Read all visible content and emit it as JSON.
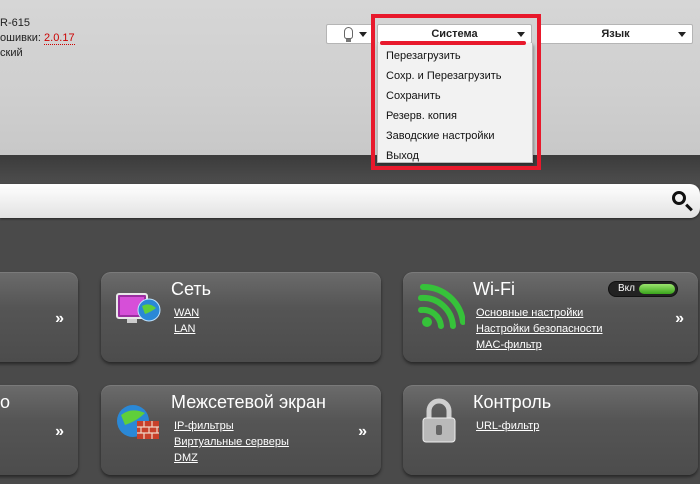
{
  "device": {
    "model_line": "R-615",
    "firmware_label": "ошивки:",
    "firmware_version": "2.0.17",
    "lang_line": "ский"
  },
  "topbar": {
    "system_label": "Система",
    "language_label": "Язык"
  },
  "system_menu": {
    "items": [
      "Перезагрузить",
      "Сохр. и Перезагрузить",
      "Сохранить",
      "Резерв. копия",
      "Заводские настройки",
      "Выход"
    ]
  },
  "tiles": {
    "net": {
      "title": "Сеть",
      "links": [
        "WAN",
        "LAN"
      ]
    },
    "wifi": {
      "title": "Wi-Fi",
      "links": [
        "Основные настройки",
        "Настройки безопасности",
        "MAC-фильтр"
      ],
      "toggle_label": "Вкл"
    },
    "firewall": {
      "title": "Межсетевой экран",
      "links": [
        "IP-фильтры",
        "Виртуальные серверы",
        "DMZ"
      ]
    },
    "control": {
      "title": "Контроль",
      "links": [
        "URL-фильтр"
      ]
    },
    "arrow": "»",
    "left2_fragment": "о"
  },
  "colors": {
    "highlight": "#e8192c",
    "firmware_version": "#cc0000",
    "toggle_on": "#3aa51c"
  }
}
